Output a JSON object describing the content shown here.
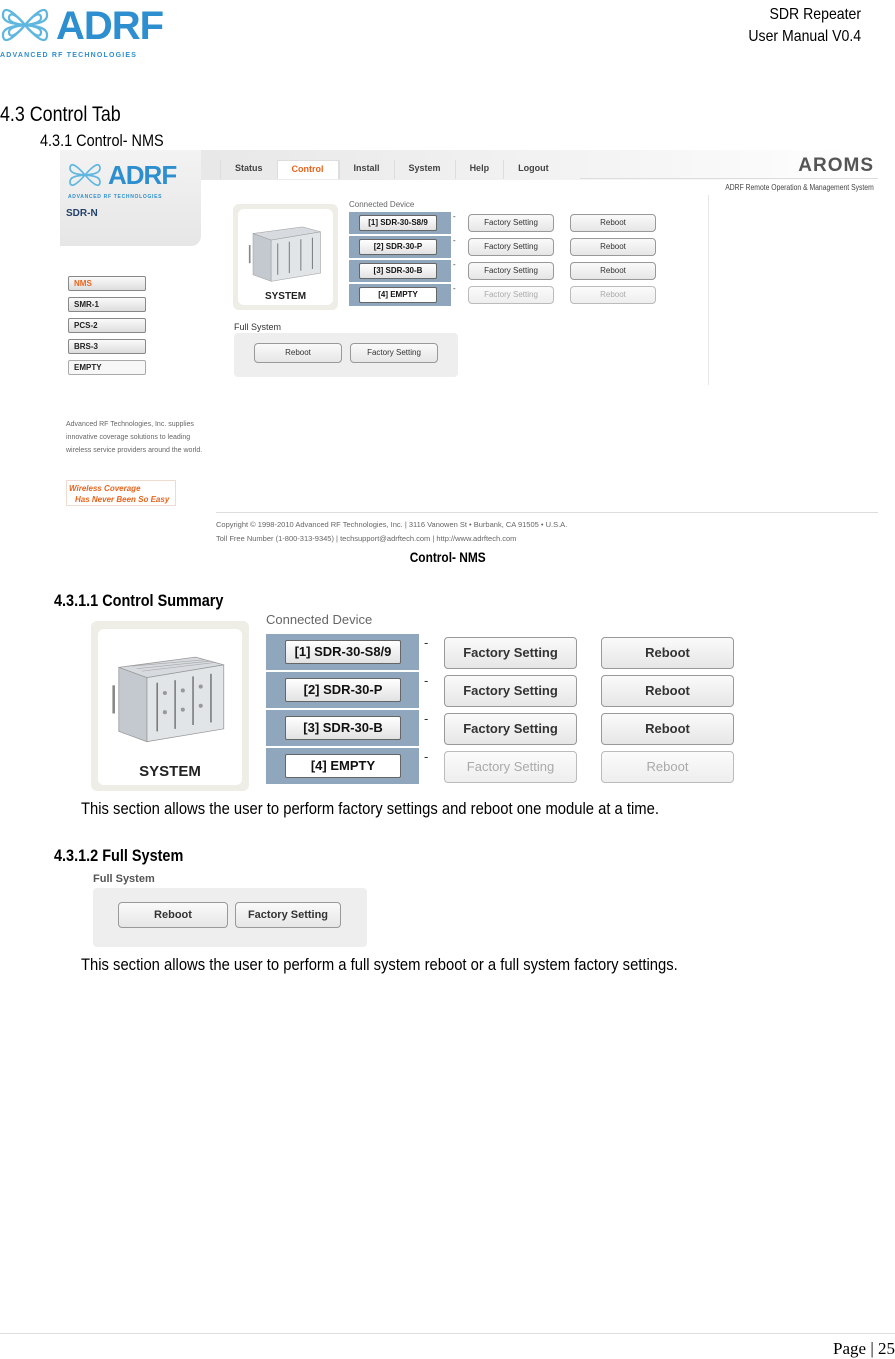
{
  "header": {
    "logo_text": "ADRF",
    "logo_subtitle": "ADVANCED RF TECHNOLOGIES",
    "doc_title_line1": "SDR Repeater",
    "doc_title_line2": "User Manual V0.4"
  },
  "headings": {
    "section": "4.3 Control Tab",
    "subsection": "4.3.1 Control- NMS",
    "summary": "4.3.1.1 Control Summary",
    "full_system": "4.3.1.2 Full System"
  },
  "screenshot": {
    "logo_text": "ADRF",
    "logo_subtitle": "ADVANCED RF TECHNOLOGIES",
    "model": "SDR-N",
    "tabs": [
      {
        "label": "Status",
        "active": false
      },
      {
        "label": "Control",
        "active": true
      },
      {
        "label": "Install",
        "active": false
      },
      {
        "label": "System",
        "active": false
      },
      {
        "label": "Help",
        "active": false
      },
      {
        "label": "Logout",
        "active": false
      }
    ],
    "brand": "AROMS",
    "brand_subtitle": "ADRF Remote Operation & Management System",
    "nav": [
      {
        "label": "NMS"
      },
      {
        "label": "SMR-1"
      },
      {
        "label": "PCS-2"
      },
      {
        "label": "BRS-3"
      },
      {
        "label": "EMPTY"
      }
    ],
    "blurb": "Advanced RF Technologies, Inc. supplies innovative coverage solutions to leading wireless service providers around the world.",
    "slogan_line1": "Wireless Coverage",
    "slogan_line2": "Has Never Been So Easy",
    "footer_line1": "Copyright © 1998-2010 Advanced RF Technologies, Inc. | 3116 Vanowen St • Burbank, CA 91505 • U.S.A.",
    "footer_line2": "Toll Free Number (1-800-313-9345) | techsupport@adrftech.com | http://www.adrftech.com"
  },
  "panel": {
    "system_label": "SYSTEM",
    "connected_title": "Connected Device",
    "dash": "-",
    "devices": [
      {
        "name": "[1] SDR-30-S8/9",
        "factory": "Factory Setting",
        "reboot": "Reboot",
        "enabled": true
      },
      {
        "name": "[2] SDR-30-P",
        "factory": "Factory Setting",
        "reboot": "Reboot",
        "enabled": true
      },
      {
        "name": "[3] SDR-30-B",
        "factory": "Factory Setting",
        "reboot": "Reboot",
        "enabled": true
      },
      {
        "name": "[4] EMPTY",
        "factory": "Factory Setting",
        "reboot": "Reboot",
        "enabled": false
      }
    ],
    "full_system_title": "Full System",
    "full_reboot": "Reboot",
    "full_factory": "Factory Setting"
  },
  "caption": "Control- NMS",
  "paragraphs": {
    "summary": "This section allows the user to perform factory settings and reboot one module at a time.",
    "full_system": "This section allows the user to perform a full system reboot or a full system factory settings."
  },
  "footer": {
    "page": "Page | 25"
  }
}
